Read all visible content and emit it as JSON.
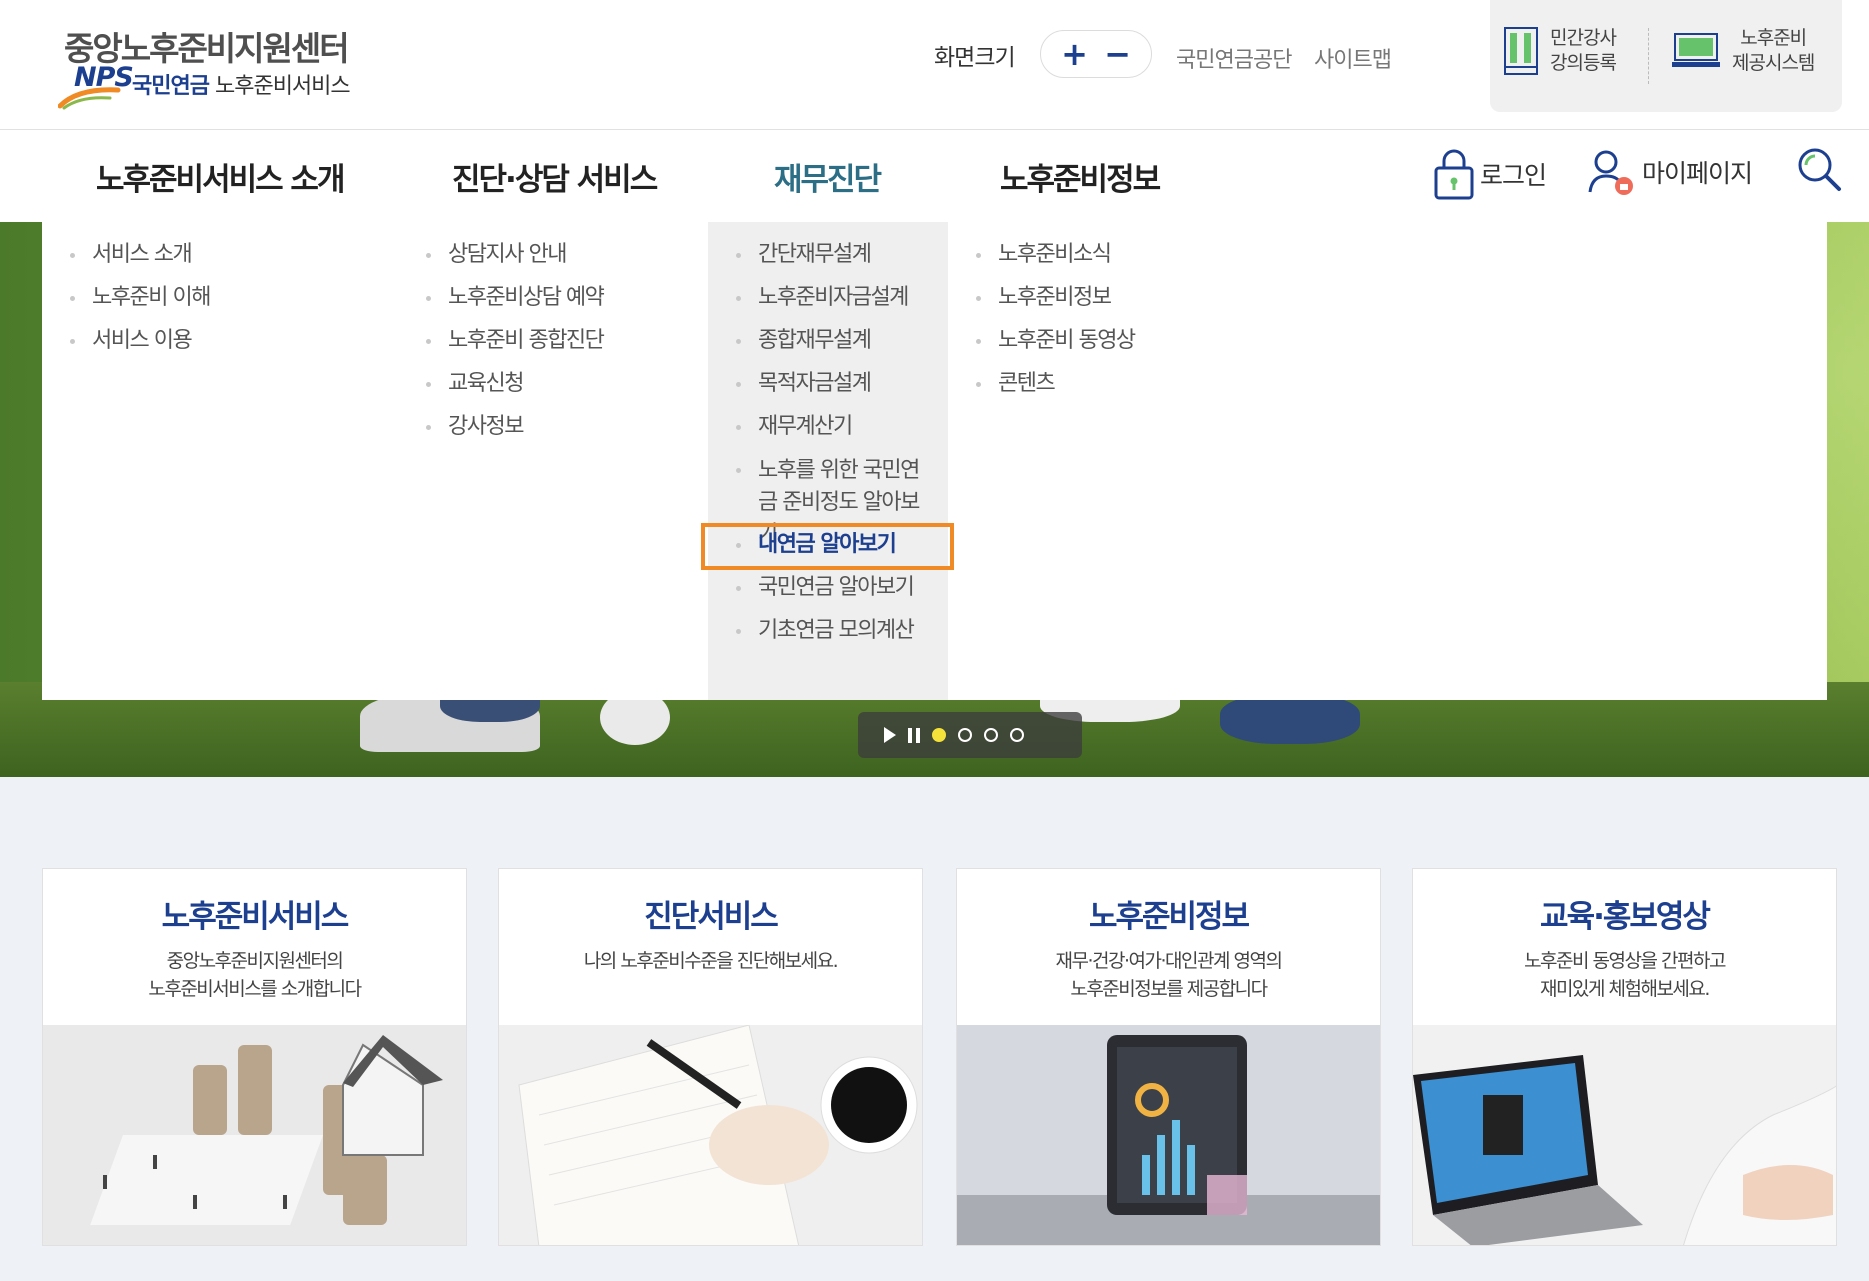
{
  "header": {
    "logo_title": "중앙노후준비지원센터",
    "logo_nps": "NPS",
    "logo_sub_strong": "국민연금",
    "logo_sub": "노후준비서비스",
    "screen_size_label": "화면크기",
    "zoom_in": "+",
    "zoom_out": "−",
    "links": [
      "국민연금공단",
      "사이트맵"
    ],
    "quick": [
      {
        "line1": "민간강사",
        "line2": "강의등록",
        "icon": "bookshelf-icon"
      },
      {
        "line1": "노후준비",
        "line2": "제공시스템",
        "icon": "monitor-icon"
      }
    ]
  },
  "gnb": {
    "items": [
      "노후준비서비스 소개",
      "진단·상담 서비스",
      "재무진단",
      "노후준비정보"
    ],
    "active_index": 2,
    "login": "로그인",
    "mypage": "마이페이지",
    "search_icon": "search-icon"
  },
  "mega_menu": {
    "col1": [
      "서비스 소개",
      "노후준비 이해",
      "서비스 이용"
    ],
    "col2": [
      "상담지사 안내",
      "노후준비상담 예약",
      "노후준비 종합진단",
      "교육신청",
      "강사정보"
    ],
    "col3": [
      "간단재무설계",
      "노후준비자금설계",
      "종합재무설계",
      "목적자금설계",
      "재무계산기",
      "노후를 위한 국민연금 준비정도 알아보기",
      "내연금 알아보기",
      "국민연금 알아보기",
      "기초연금 모의계산"
    ],
    "col3_highlight_index": 6,
    "col4": [
      "노후준비소식",
      "노후준비정보",
      "노후준비 동영상",
      "콘텐츠"
    ]
  },
  "slider": {
    "dots": 4,
    "active_dot": 0
  },
  "cards": [
    {
      "title": "노후준비서비스",
      "desc": "중앙노후준비지원센터의\n노후준비서비스를 소개합니다"
    },
    {
      "title": "진단서비스",
      "desc": "나의 노후준비수준을 진단해보세요."
    },
    {
      "title": "노후준비정보",
      "desc": "재무·건강·여가·대인관계 영역의\n노후준비정보를 제공합니다"
    },
    {
      "title": "교육·홍보영상",
      "desc": "노후준비 동영상을 간편하고\n재미있게 체험해보세요."
    }
  ],
  "colors": {
    "brand_blue": "#1d3f8f",
    "active_teal": "#2c6e86",
    "highlight_orange": "#f08a24"
  }
}
